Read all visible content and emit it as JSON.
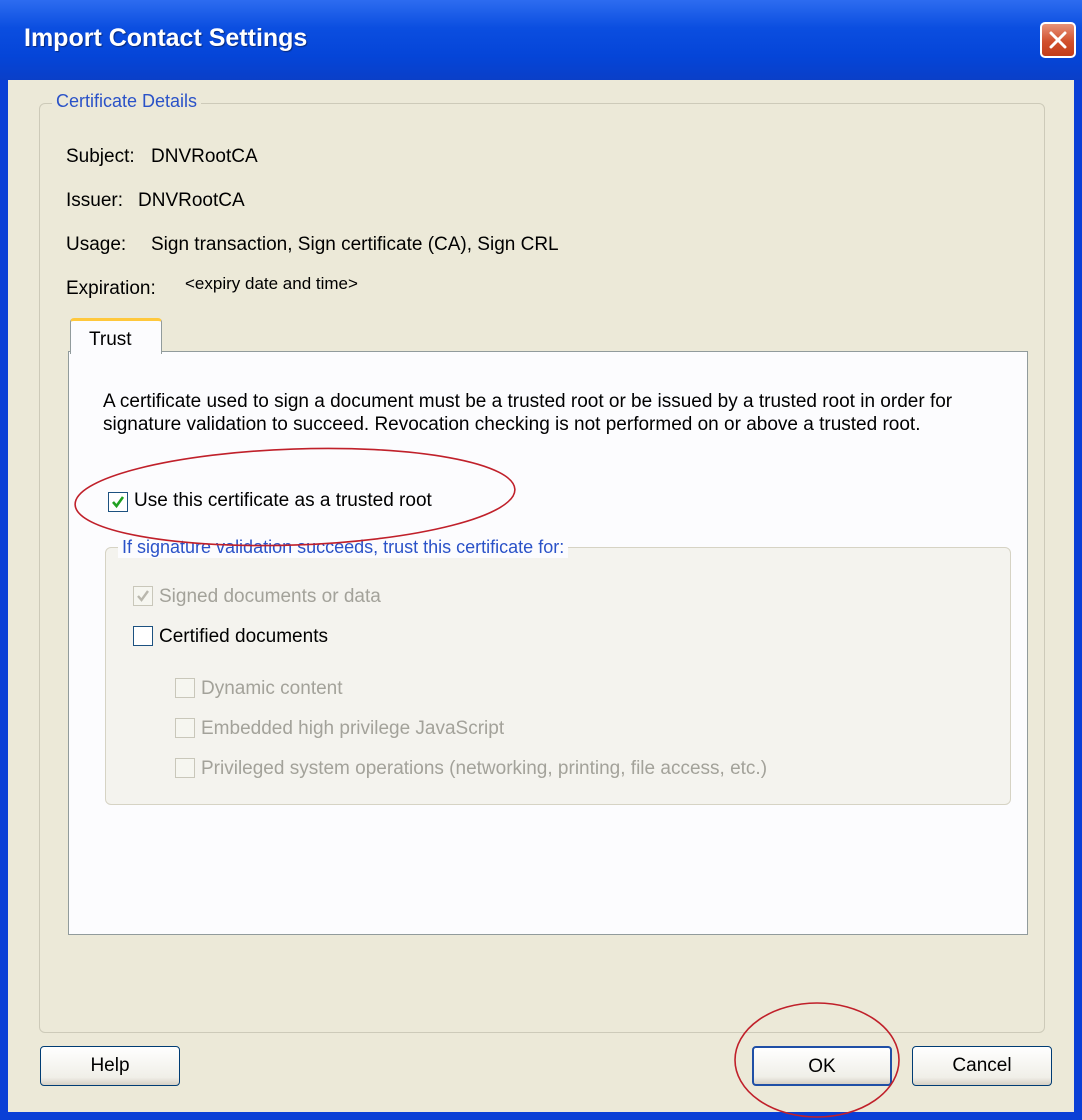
{
  "window": {
    "title": "Import Contact Settings"
  },
  "certificate_details": {
    "legend": "Certificate Details",
    "subject_label": "Subject:",
    "subject_value": "DNVRootCA",
    "issuer_label": "Issuer:",
    "issuer_value": "DNVRootCA",
    "usage_label": "Usage:",
    "usage_value": "Sign transaction, Sign certificate (CA), Sign CRL",
    "expiration_label": "Expiration:",
    "expiration_value": "<expiry date and time>"
  },
  "tabs": [
    {
      "label": "Trust",
      "selected": true
    }
  ],
  "trust": {
    "description": "A certificate used to sign a document must be a trusted root or be issued by a trusted root in order for signature validation to succeed.  Revocation checking is not performed on or above a trusted root.",
    "trusted_root": {
      "label": "Use this certificate as a trusted root",
      "checked": true
    },
    "group_legend": "If signature validation succeeds, trust this certificate for:",
    "options": [
      {
        "label": "Signed documents or data",
        "checked": true,
        "enabled": false
      },
      {
        "label": "Certified documents",
        "checked": false,
        "enabled": true
      },
      {
        "label": "Dynamic content",
        "checked": false,
        "enabled": false
      },
      {
        "label": "Embedded high privilege JavaScript",
        "checked": false,
        "enabled": false
      },
      {
        "label": "Privileged system operations (networking, printing, file access, etc.)",
        "checked": false,
        "enabled": false
      }
    ]
  },
  "buttons": {
    "help": "Help",
    "ok": "OK",
    "cancel": "Cancel"
  },
  "colors": {
    "title_bar": "#0545d8",
    "dialog_bg": "#ece9d8",
    "annotation": "#c0202a",
    "legend_text": "#2a52c8"
  }
}
